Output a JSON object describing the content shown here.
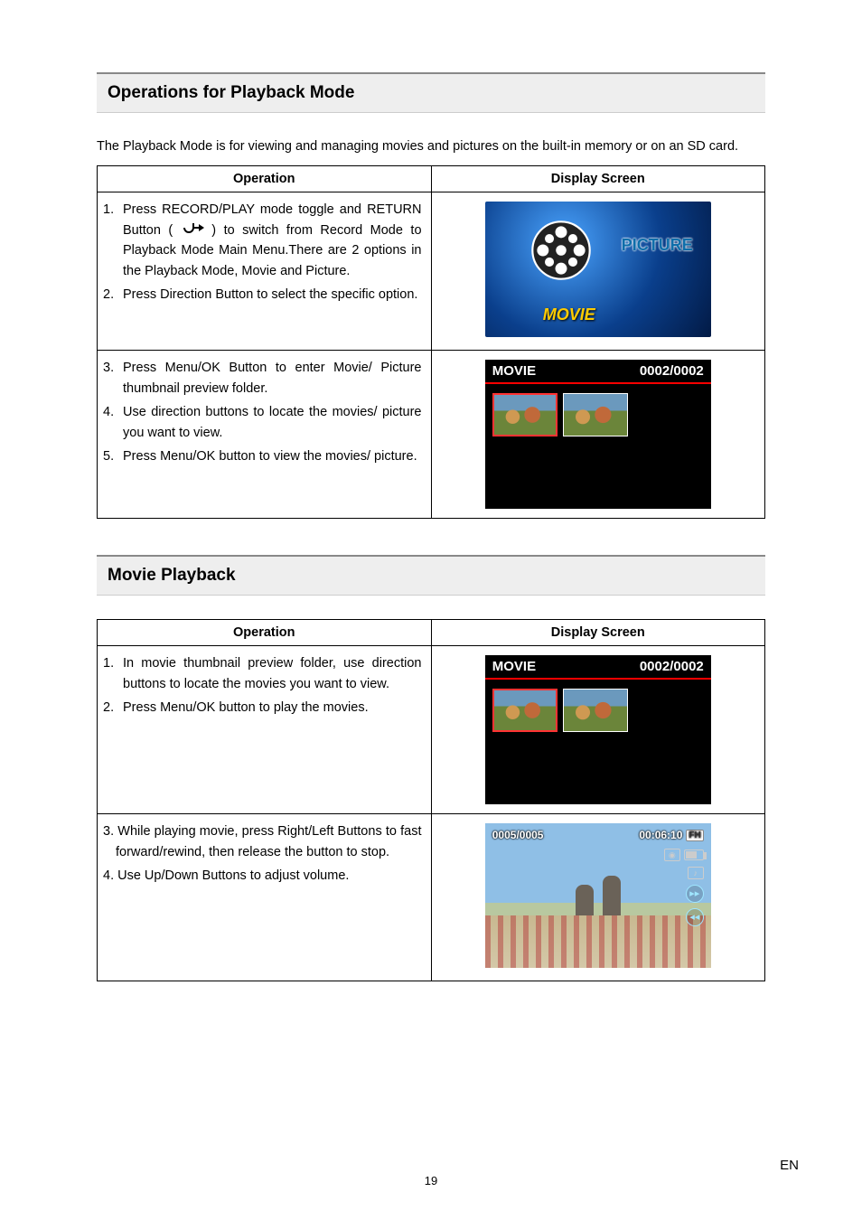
{
  "page_number": "19",
  "lang_code": "EN",
  "section1": {
    "heading": "Operations for Playback Mode",
    "intro": "The Playback Mode is for viewing and managing movies and pictures on the built-in memory or on an SD card.",
    "col_operation": "Operation",
    "col_display": "Display Screen",
    "row1": {
      "item1_num": "1.",
      "item1_txt_a": "Press RECORD/PLAY mode toggle and RETURN Button (",
      "item1_txt_b": ") to switch from Record Mode to Playback Mode Main Menu.There are 2 options in the Playback Mode, Movie and Picture.",
      "item2_num": "2.",
      "item2_txt": "Press Direction Button to select the specific option.",
      "screen": {
        "picture_label": "PICTURE",
        "movie_label": "MOVIE"
      }
    },
    "row2": {
      "item3_num": "3.",
      "item3_txt": "Press Menu/OK Button to enter Movie/ Picture thumbnail preview folder.",
      "item4_num": "4.",
      "item4_txt": "Use direction buttons to locate the movies/ picture you want to view.",
      "item5_num": "5.",
      "item5_txt": "Press Menu/OK button to view the movies/ picture.",
      "screen": {
        "title": "MOVIE",
        "counter": "0002/0002"
      }
    }
  },
  "section2": {
    "heading": "Movie Playback",
    "col_operation": "Operation",
    "col_display": "Display Screen",
    "row1": {
      "item1_num": "1.",
      "item1_txt": "In movie thumbnail preview folder, use direction buttons to locate the movies you want to view.",
      "item2_num": "2.",
      "item2_txt": "Press Menu/OK button to play the movies.",
      "screen": {
        "title": "MOVIE",
        "counter": "0002/0002"
      }
    },
    "row2": {
      "item3_txt": "3. While playing movie, press Right/Left Buttons to fast forward/rewind, then release the button to stop.",
      "item4_txt": "4. Use Up/Down Buttons to adjust volume.",
      "screen": {
        "index": "0005/0005",
        "time": "00:06:10",
        "quality": "FH",
        "fwd": "▸▸",
        "rew": "◂◂"
      }
    }
  }
}
